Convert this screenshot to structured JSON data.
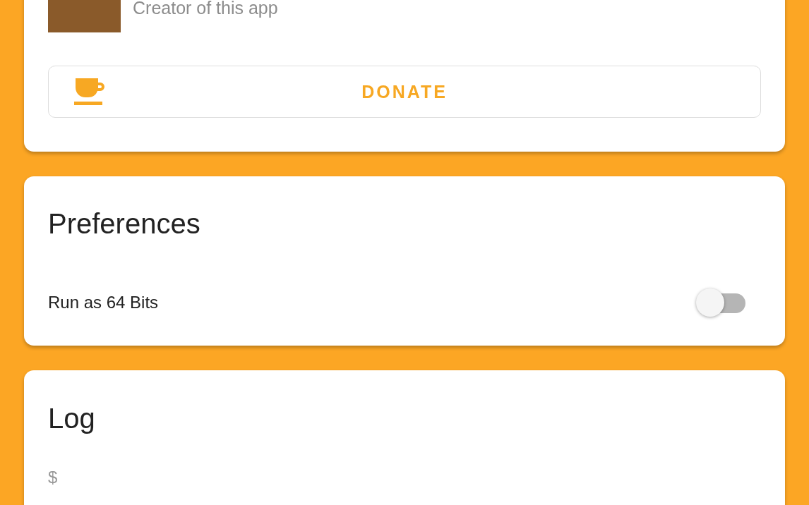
{
  "creator": {
    "subtitle": "Creator of this app"
  },
  "donate_button": {
    "label": "DONATE"
  },
  "preferences": {
    "title": "Preferences",
    "settings": [
      {
        "label": "Run as 64 Bits",
        "kind": "switch",
        "on": false
      }
    ]
  },
  "log": {
    "title": "Log",
    "lines": [
      "$"
    ]
  }
}
